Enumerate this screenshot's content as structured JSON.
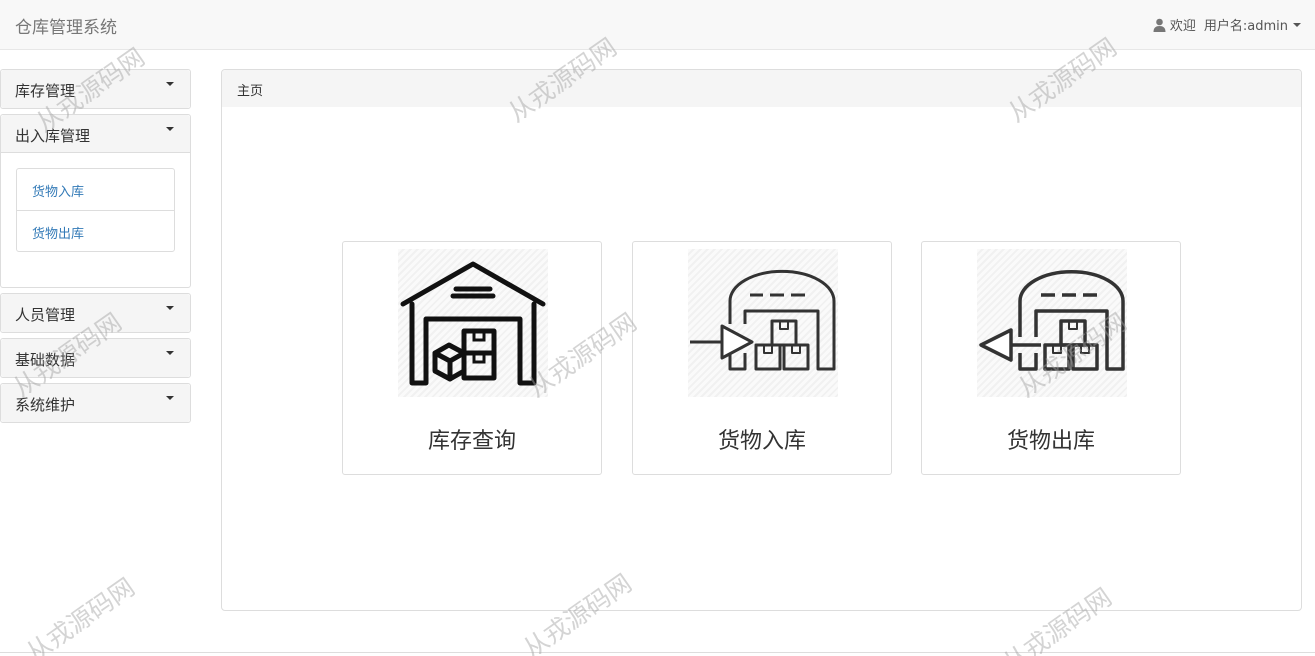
{
  "app": {
    "title": "仓库管理系统"
  },
  "user": {
    "welcome": "欢迎",
    "username_label": "用户名:admin"
  },
  "sidebar": {
    "groups": [
      {
        "label": "库存管理",
        "items": []
      },
      {
        "label": "出入库管理",
        "items": [
          {
            "label": "货物入库"
          },
          {
            "label": "货物出库"
          }
        ]
      },
      {
        "label": "人员管理",
        "items": []
      },
      {
        "label": "基础数据",
        "items": []
      },
      {
        "label": "系统维护",
        "items": []
      }
    ]
  },
  "main": {
    "heading": "主页",
    "cards": [
      {
        "label": "库存查询",
        "icon": "warehouse-boxes-icon"
      },
      {
        "label": "货物入库",
        "icon": "warehouse-inbound-icon"
      },
      {
        "label": "货物出库",
        "icon": "warehouse-outbound-icon"
      }
    ]
  },
  "watermark": {
    "text": "从戎源码网"
  }
}
